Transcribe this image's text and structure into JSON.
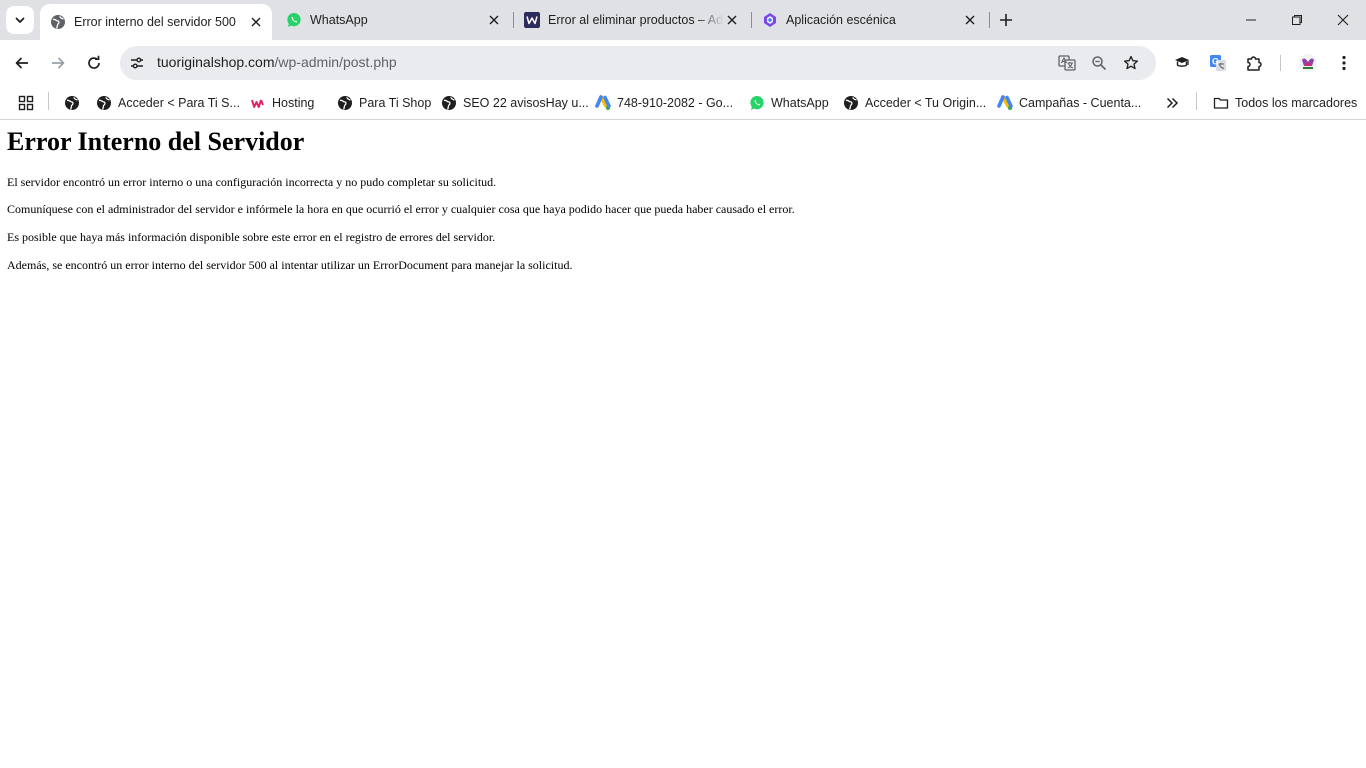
{
  "browser": {
    "tabs": [
      {
        "title": "Error interno del servidor 500",
        "active": true
      },
      {
        "title": "WhatsApp",
        "active": false
      },
      {
        "title": "Error al eliminar productos – Ad",
        "active": false
      },
      {
        "title": "Aplicación escénica",
        "active": false
      }
    ],
    "address_bar": {
      "host": "tuoriginalshop.com",
      "path": "/wp-admin/post.php"
    },
    "bookmarks": [
      {
        "label": ""
      },
      {
        "label": "Acceder < Para Ti S..."
      },
      {
        "label": "Hosting"
      },
      {
        "label": "Para Ti Shop"
      },
      {
        "label": "SEO 22 avisosHay u..."
      },
      {
        "label": "748-910-2082 - Go..."
      },
      {
        "label": "WhatsApp"
      },
      {
        "label": "Acceder < Tu Origin..."
      },
      {
        "label": "Campañas - Cuenta..."
      }
    ],
    "all_bookmarks_label": "Todos los marcadores"
  },
  "page": {
    "heading": "Error Interno del Servidor",
    "paragraphs": [
      "El servidor encontró un error interno o una configuración incorrecta y no pudo completar su solicitud.",
      "Comuníquese con el administrador del servidor e infórmele la hora en que ocurrió el error y cualquier cosa que haya podido hacer que pueda haber causado el error.",
      "Es posible que haya más información disponible sobre este error en el registro de errores del servidor.",
      "Además, se encontró un error interno del servidor 500 al intentar utilizar un ErrorDocument para manejar la solicitud."
    ]
  },
  "colors": {
    "tabstrip_bg": "#dfe1e5",
    "omnibox_bg": "#e9ebee",
    "whatsapp_green": "#25d366",
    "hosting_red": "#e0245e",
    "ads_blue": "#4285f4",
    "ads_yellow": "#fbbc04"
  },
  "icons": [
    "tab-search-icon",
    "globe-icon",
    "whatsapp-icon",
    "w-logo-icon",
    "flutter-icon",
    "close-icon",
    "plus-icon",
    "minimize-icon",
    "restore-icon",
    "window-close-icon",
    "back-icon",
    "forward-icon",
    "reload-icon",
    "site-settings-icon",
    "translate-icon",
    "zoom-icon",
    "star-icon",
    "extension-icon",
    "google-translate-icon",
    "puzzle-icon",
    "profile-icon",
    "menu-icon",
    "apps-grid-icon",
    "google-ads-icon",
    "chevron-double-right-icon",
    "folder-icon"
  ]
}
